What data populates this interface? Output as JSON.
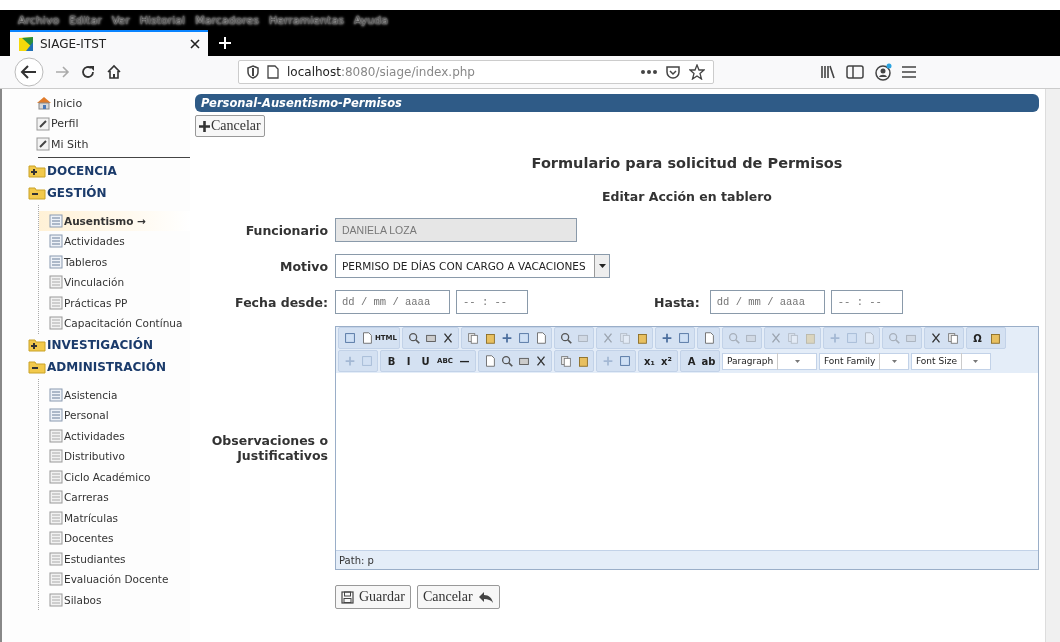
{
  "browser": {
    "menu": [
      "Archivo",
      "Editar",
      "Ver",
      "Historial",
      "Marcadores",
      "Herramientas",
      "Ayuda"
    ],
    "tab": {
      "title": "SIAGE-ITST",
      "selected": true
    },
    "url": {
      "host": "localhost",
      "rest": ":8080/siage/index.php"
    }
  },
  "sidebar": {
    "items": [
      {
        "label": "Inicio",
        "kind": "home"
      },
      {
        "label": "Perfil",
        "kind": "edit"
      },
      {
        "label": "Mi Sith",
        "kind": "edit"
      },
      {
        "label": "DOCENCIA",
        "kind": "folder",
        "expanded": false
      },
      {
        "label": "GESTIÓN",
        "kind": "folder",
        "expanded": true,
        "children": [
          {
            "label": "Ausentismo →",
            "kind": "list",
            "selected": true
          },
          {
            "label": "Actividades",
            "kind": "list",
            "selected": false
          },
          {
            "label": "Tableros",
            "kind": "list",
            "selected": false
          },
          {
            "label": "Vinculación",
            "kind": "page",
            "selected": false
          },
          {
            "label": "Prácticas PP",
            "kind": "page",
            "selected": false
          },
          {
            "label": "Capacitación Contínua",
            "kind": "page",
            "selected": false
          }
        ]
      },
      {
        "label": "INVESTIGACIÓN",
        "kind": "folder",
        "expanded": false
      },
      {
        "label": "ADMINISTRACIÓN",
        "kind": "folder",
        "expanded": true,
        "children": [
          {
            "label": "Asistencia",
            "kind": "list",
            "selected": false
          },
          {
            "label": "Personal",
            "kind": "list",
            "selected": false
          },
          {
            "label": "Actividades",
            "kind": "page",
            "selected": false
          },
          {
            "label": "Distributivo",
            "kind": "page",
            "selected": false
          },
          {
            "label": "Ciclo Académico",
            "kind": "page",
            "selected": false
          },
          {
            "label": "Carreras",
            "kind": "page",
            "selected": false
          },
          {
            "label": "Matrículas",
            "kind": "page",
            "selected": false
          },
          {
            "label": "Docentes",
            "kind": "page",
            "selected": false
          },
          {
            "label": "Estudiantes",
            "kind": "page",
            "selected": false
          },
          {
            "label": "Evaluación Docente",
            "kind": "page",
            "selected": false
          },
          {
            "label": "Silabos",
            "kind": "page",
            "selected": false
          }
        ]
      }
    ]
  },
  "content": {
    "header": "Personal-Ausentismo-Permisos",
    "top_button": "Cancelar",
    "title": "Formulario para solicitud de Permisos",
    "subtitle": "Editar Acción en tablero",
    "funcionario": {
      "label": "Funcionario",
      "value": "DANIELA LOZA",
      "disabled": true
    },
    "motivo": {
      "label": "Motivo",
      "value": "PERMISO DE DÍAS CON CARGO A VACACIONES"
    },
    "fecha_desde": {
      "label": "Fecha desde:",
      "date_placeholder": "dd / mm / aaaa",
      "time_placeholder": "-- : --"
    },
    "hasta": {
      "label": "Hasta:",
      "date_placeholder": "dd / mm / aaaa",
      "time_placeholder": "-- : --"
    },
    "observaciones": {
      "label": "Observaciones o Justificativos",
      "toolbar_rows": [
        [
          [
            {
              "disabled": false
            },
            {
              "disabled": false
            },
            {
              "label": "HTML",
              "disabled": false
            }
          ],
          [
            {
              "disabled": false
            },
            {
              "disabled": false
            },
            {
              "disabled": false
            }
          ],
          [
            {
              "disabled": false
            },
            {
              "disabled": false
            },
            {
              "disabled": false
            },
            {
              "disabled": false
            },
            {
              "disabled": false
            }
          ],
          [
            {
              "disabled": false
            },
            {
              "disabled": true
            }
          ],
          [
            {
              "disabled": true
            },
            {
              "disabled": true
            },
            {
              "disabled": false
            }
          ],
          [
            {
              "disabled": false
            },
            {
              "disabled": false
            }
          ],
          [
            {
              "disabled": false
            }
          ],
          [
            {
              "disabled": true
            },
            {
              "disabled": true
            }
          ],
          [
            {
              "disabled": true
            },
            {
              "disabled": true
            },
            {
              "disabled": true
            }
          ],
          [
            {
              "disabled": true
            },
            {
              "disabled": true
            },
            {
              "disabled": true
            }
          ],
          [
            {
              "disabled": true
            },
            {
              "disabled": true
            }
          ],
          [
            {
              "disabled": false
            },
            {
              "disabled": false
            }
          ],
          [
            {
              "label": "Ω",
              "disabled": false
            },
            {
              "disabled": false
            }
          ]
        ],
        [
          [
            {
              "disabled": true
            },
            {
              "disabled": true
            }
          ],
          [
            {
              "label": "B",
              "disabled": false
            },
            {
              "label": "I",
              "disabled": false
            },
            {
              "label": "U",
              "disabled": false
            },
            {
              "label": "ABC",
              "disabled": false
            },
            {
              "label": "—",
              "disabled": false
            }
          ],
          [
            {
              "disabled": false
            },
            {
              "disabled": false
            },
            {
              "disabled": false
            },
            {
              "disabled": false
            }
          ],
          [
            {
              "disabled": false
            },
            {
              "disabled": false
            }
          ],
          [
            {
              "disabled": true
            },
            {
              "disabled": false
            }
          ],
          [
            {
              "label": "x₁",
              "disabled": false
            },
            {
              "label": "x²",
              "disabled": false
            }
          ],
          [
            {
              "label": "A",
              "disabled": false
            },
            {
              "label": "ab",
              "disabled": false
            }
          ]
        ]
      ],
      "dropdowns": [
        "Paragraph",
        "Font Family",
        "Font Size"
      ],
      "path": "Path: p"
    },
    "buttons": [
      {
        "label": "Guardar",
        "kind": "save"
      },
      {
        "label": "Cancelar",
        "kind": "back"
      }
    ]
  }
}
